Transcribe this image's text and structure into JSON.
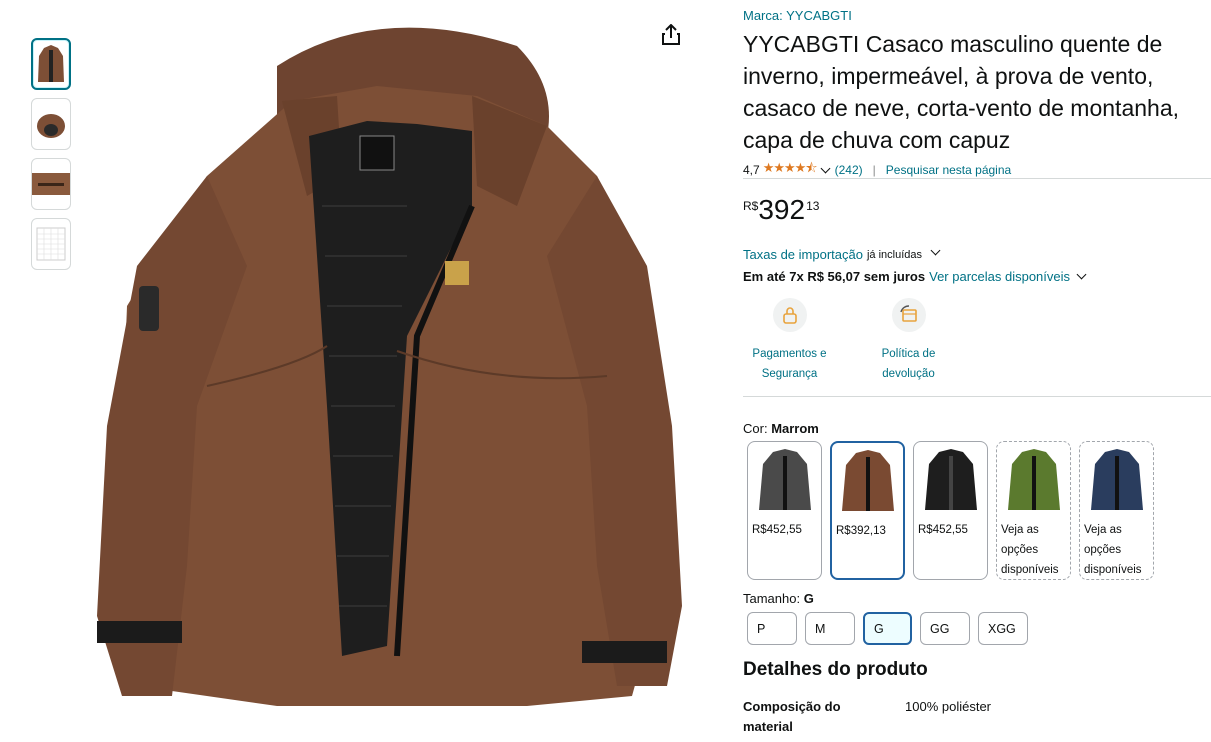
{
  "product": {
    "brand_text": "Marca: YYCABGTI",
    "title": "YYCABGTI Casaco masculino quente de inverno, impermeável, à prova de vento, casaco de neve, corta-vento de montanha, capa de chuva com capuz",
    "rating_value": "4,7",
    "stars": "★★★★⯪",
    "review_count": "(242)",
    "rating_separator": "|",
    "search_page_link": "Pesquisar nesta página"
  },
  "price": {
    "currency": "R$",
    "whole": "392",
    "fraction": "13"
  },
  "import": {
    "link": "Taxas de importação",
    "note": "já incluídas"
  },
  "installments": {
    "text": "Em até 7x R$ 56,07 sem juros",
    "link": "Ver parcelas disponíveis"
  },
  "features": [
    {
      "label_line1": "Pagamentos e",
      "label_line2": "Segurança",
      "icon": "lock-icon"
    },
    {
      "label_line1": "Política de",
      "label_line2": "devolução",
      "icon": "return-icon"
    }
  ],
  "color": {
    "label": "Cor:",
    "selected": "Marrom",
    "options": [
      {
        "price": "R$452,55",
        "color": "#4a4a4a"
      },
      {
        "price": "R$392,13",
        "color": "#7a4a32"
      },
      {
        "price": "R$452,55",
        "color": "#1e1e1e"
      },
      {
        "text_line1": "Veja as",
        "text_line2": "opções",
        "text_line3": "disponíveis",
        "color": "#5b7a2e"
      },
      {
        "text_line1": "Veja as",
        "text_line2": "opções",
        "text_line3": "disponíveis",
        "color": "#2a3d5e"
      }
    ]
  },
  "size": {
    "label": "Tamanho:",
    "selected": "G",
    "options": [
      "P",
      "M",
      "G",
      "GG",
      "XGG"
    ]
  },
  "details": {
    "heading": "Detalhes do produto",
    "rows": [
      {
        "key_line1": "Composição do",
        "key_line2": "material",
        "value": "100% poliéster"
      }
    ]
  },
  "colors": {
    "link": "#007185",
    "star": "#de7921",
    "selected_border": "#2162a1",
    "jacket_brown": "#7d4f36"
  }
}
